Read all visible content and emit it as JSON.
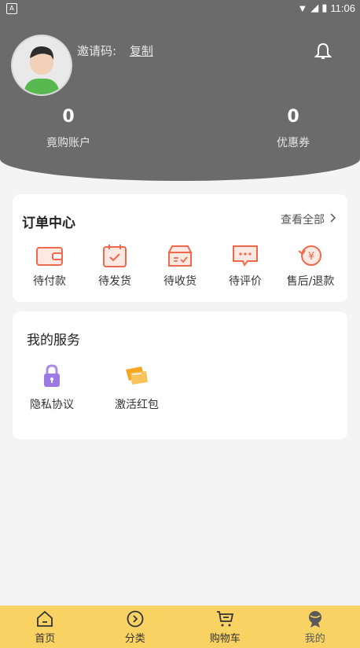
{
  "status_bar": {
    "time": "11:06"
  },
  "header": {
    "invite_label": "邀请码:",
    "copy_label": "复制",
    "stats": [
      {
        "value": "0",
        "label": "竟购账户"
      },
      {
        "value": "0",
        "label": "优惠券"
      }
    ]
  },
  "orders": {
    "title": "订单中心",
    "view_all": "查看全部",
    "items": [
      {
        "label": "待付款",
        "icon": "wallet-icon"
      },
      {
        "label": "待发货",
        "icon": "calendar-check-icon"
      },
      {
        "label": "待收货",
        "icon": "box-icon"
      },
      {
        "label": "待评价",
        "icon": "comment-icon"
      },
      {
        "label": "售后/退款",
        "icon": "refund-icon"
      }
    ]
  },
  "services": {
    "title": "我的服务",
    "items": [
      {
        "label": "隐私协议",
        "icon": "lock-icon"
      },
      {
        "label": "激活红包",
        "icon": "red-envelope-icon"
      }
    ]
  },
  "tabbar": {
    "items": [
      {
        "label": "首页",
        "icon": "home-icon"
      },
      {
        "label": "分类",
        "icon": "category-icon"
      },
      {
        "label": "购物车",
        "icon": "cart-icon"
      },
      {
        "label": "我的",
        "icon": "profile-icon"
      }
    ]
  },
  "colors": {
    "header": "#6b6b6b",
    "accent": "#ef6a4d",
    "tabbar": "#f8d262"
  }
}
